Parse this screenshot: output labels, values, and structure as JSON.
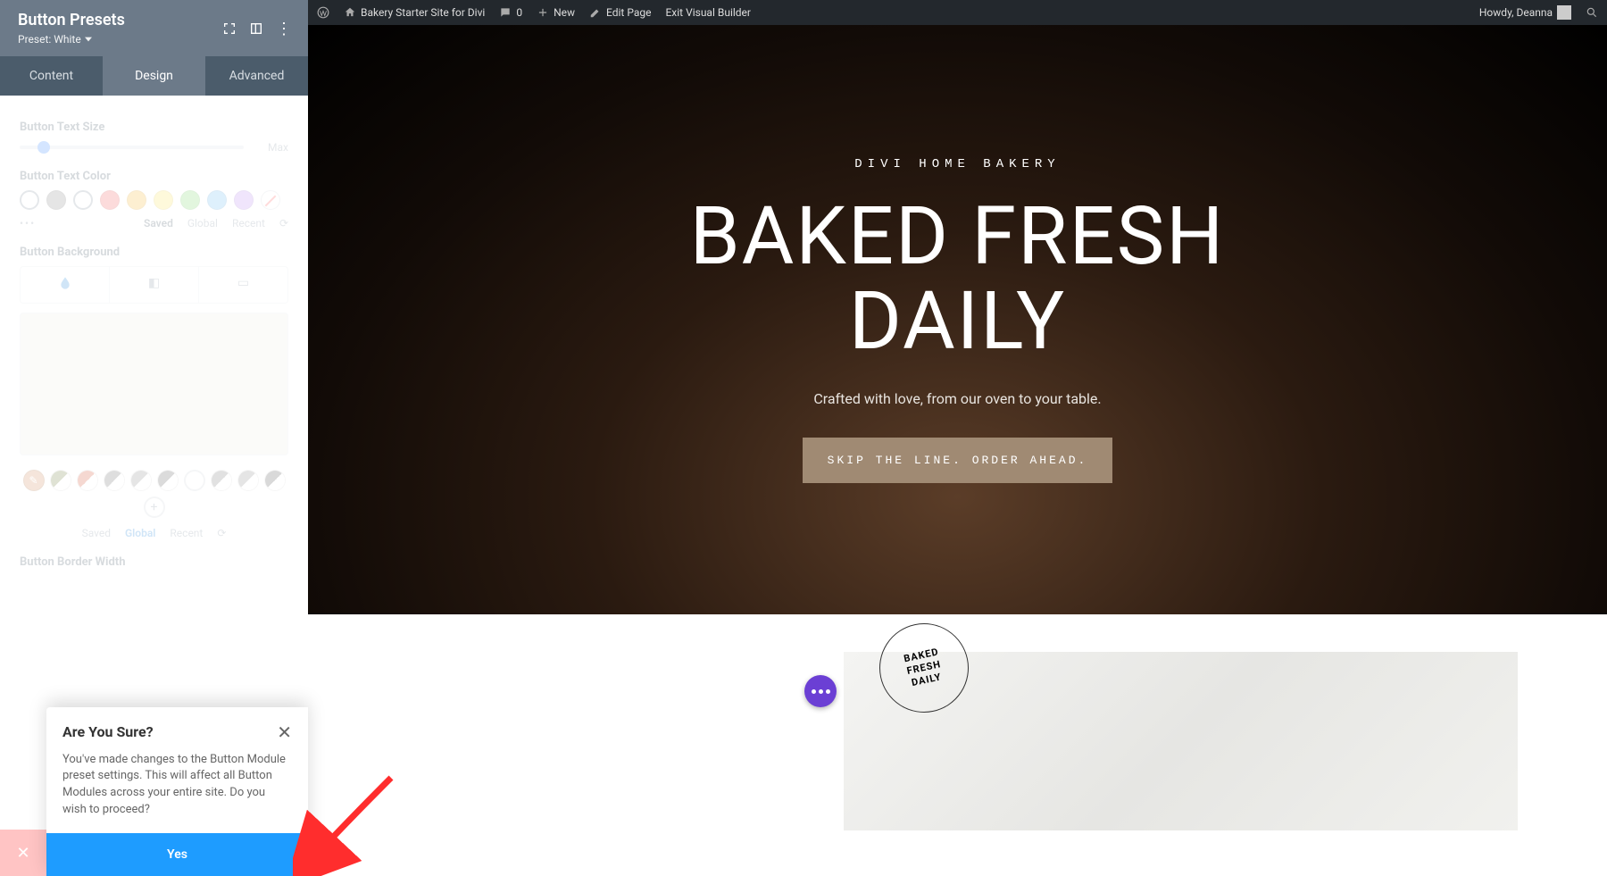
{
  "panel": {
    "title": "Button Presets",
    "preset_label": "Preset: White",
    "tabs": {
      "content": "Content",
      "design": "Design",
      "advanced": "Advanced"
    },
    "text_size_label": "Button Text Size",
    "slider_max": "Max",
    "text_color_label": "Button Text Color",
    "sub_tabs": {
      "saved": "Saved",
      "global": "Global",
      "recent": "Recent"
    },
    "background_label": "Button Background",
    "border_width_label": "Button Border Width",
    "color_swatches": [
      "#878787",
      "#f05a5a",
      "#f7b731",
      "#fbe25c",
      "#7bd66b",
      "#6bb9f0",
      "#b98bf0"
    ]
  },
  "confirm": {
    "title": "Are You Sure?",
    "body": "You've made changes to the Button Module preset settings. This will affect all Button Modules across your entire site. Do you wish to proceed?",
    "yes": "Yes"
  },
  "wpbar": {
    "site": "Bakery Starter Site for Divi",
    "comments": "0",
    "new": "New",
    "edit": "Edit Page",
    "exit": "Exit Visual Builder",
    "howdy": "Howdy, Deanna"
  },
  "hero": {
    "eyebrow": "DIVI HOME BAKERY",
    "title_l1": "BAKED FRESH",
    "title_l2": "DAILY",
    "sub": "Crafted with love, from our oven to your table.",
    "cta": "SKIP THE LINE. ORDER AHEAD."
  },
  "badge": "BAKED\nFRESH\nDAILY"
}
